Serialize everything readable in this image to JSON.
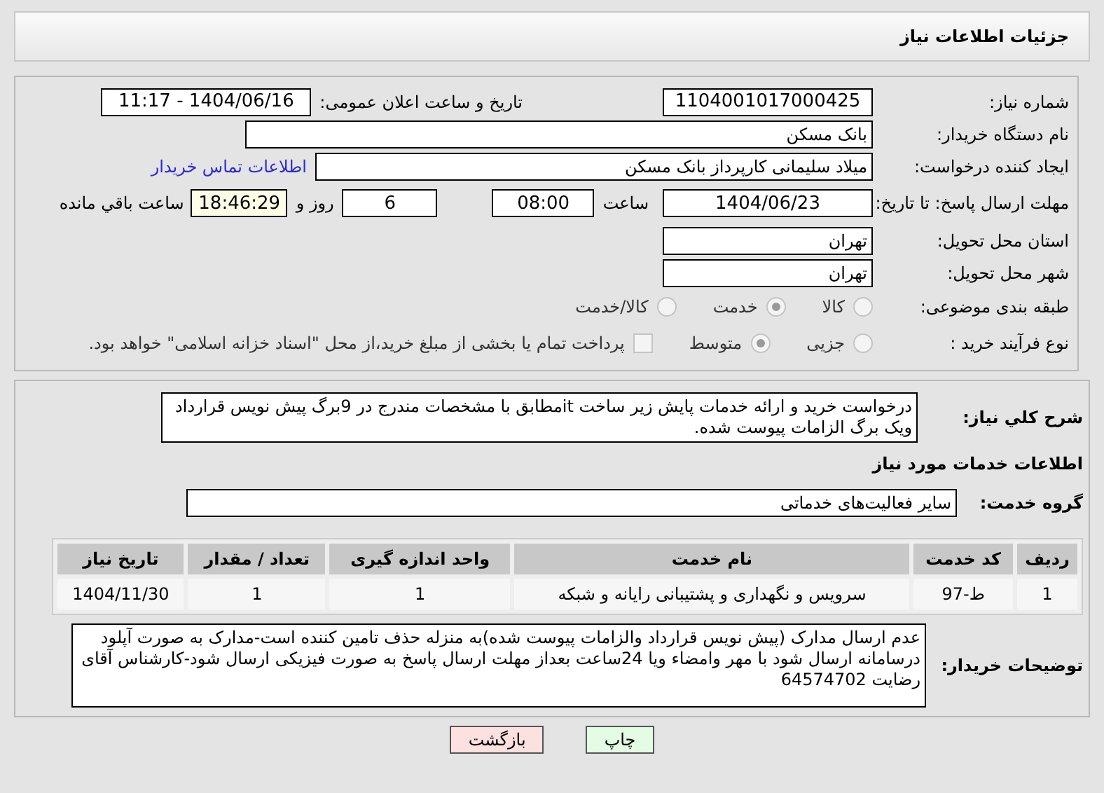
{
  "header": {
    "title": "جزئیات اطلاعات نیاز"
  },
  "need_number": {
    "label": "شماره نیاز:",
    "value": "1104001017000425"
  },
  "announce": {
    "label": "تاریخ و ساعت اعلان عمومی:",
    "value": "1404/06/16 - 11:17"
  },
  "buyer_org": {
    "label": "نام دستگاه خریدار:",
    "value": "بانک مسکن"
  },
  "creator": {
    "label": "ایجاد کننده درخواست:",
    "value": "میلاد سلیمانی کارپرداز بانک مسکن",
    "link": "اطلاعات تماس خریدار"
  },
  "deadline": {
    "label": "مهلت ارسال پاسخ: تا تاریخ:",
    "date": "1404/06/23",
    "time_label": "ساعت",
    "time": "08:00",
    "days": "6",
    "days_label": "روز و",
    "remaining": "18:46:29",
    "remaining_label": "ساعت باقي مانده"
  },
  "province": {
    "label": "استان محل تحویل:",
    "value": "تهران"
  },
  "city": {
    "label": "شهر محل تحویل:",
    "value": "تهران"
  },
  "category": {
    "label": "طبقه بندی موضوعی:",
    "options": [
      {
        "label": "کالا",
        "selected": false
      },
      {
        "label": "خدمت",
        "selected": true
      },
      {
        "label": "کالا/خدمت",
        "selected": false
      }
    ]
  },
  "process": {
    "label": "نوع فرآیند خرید :",
    "options": [
      {
        "label": "جزیی",
        "selected": false
      },
      {
        "label": "متوسط",
        "selected": true
      }
    ],
    "treasury": {
      "checked": false,
      "label": "پرداخت تمام یا بخشی از مبلغ خرید،از محل \"اسناد خزانه اسلامی\" خواهد بود."
    }
  },
  "summary": {
    "label": "شرح كلي نياز:",
    "value": "درخواست خرید و ارائه خدمات پایش زیر ساخت itمطابق با مشخصات مندرج در 9برگ پیش نویس قرارداد ویک برگ الزامات پیوست شده."
  },
  "services_heading": "اطلاعات خدمات مورد نیاز",
  "service_group": {
    "label": "گروه خدمت:",
    "value": "سایر فعالیت‌های خدماتی"
  },
  "table": {
    "columns": [
      "ردیف",
      "کد خدمت",
      "نام خدمت",
      "واحد اندازه گیری",
      "تعداد / مقدار",
      "تاریخ نیاز"
    ],
    "rows": [
      [
        "1",
        "ط-97",
        "سرویس و نگهداری و پشتیبانی رایانه و شبکه",
        "1",
        "1",
        "1404/11/30"
      ]
    ]
  },
  "buyer_notes": {
    "label": "توضیحات خریدار:",
    "value": "عدم ارسال مدارک (پیش نویس قرارداد والزامات پیوست شده)به منزله حذف تامین کننده است-مدارک به صورت آپلود درسامانه ارسال شود با مهر وامضاء ویا 24ساعت بعداز مهلت ارسال پاسخ به صورت فیزیکی ارسال شود-کارشناس آقای رضایت 64574702"
  },
  "buttons": [
    {
      "kind": "print",
      "label": "چاپ"
    },
    {
      "kind": "back",
      "label": "بازگشت"
    }
  ]
}
